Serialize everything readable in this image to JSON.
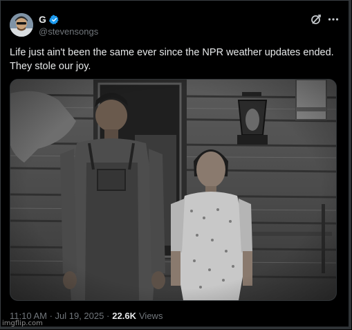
{
  "post": {
    "display_name": "G",
    "handle": "@stevensongs",
    "text": "Life just ain't been the same ever since the NPR weather updates ended.\nThey stole our joy.",
    "timestamp": "11:10 AM · Jul 19, 2025 ·",
    "views_count": "22.6K",
    "views_label": "Views"
  },
  "icons": {
    "verified": "verified-badge-icon",
    "grok": "grok-icon",
    "more": "more-icon"
  },
  "colors": {
    "background": "#000000",
    "text": "#e7e9ea",
    "muted": "#71767b",
    "verified": "#1d9bf0"
  },
  "watermark": "imgflip.com"
}
